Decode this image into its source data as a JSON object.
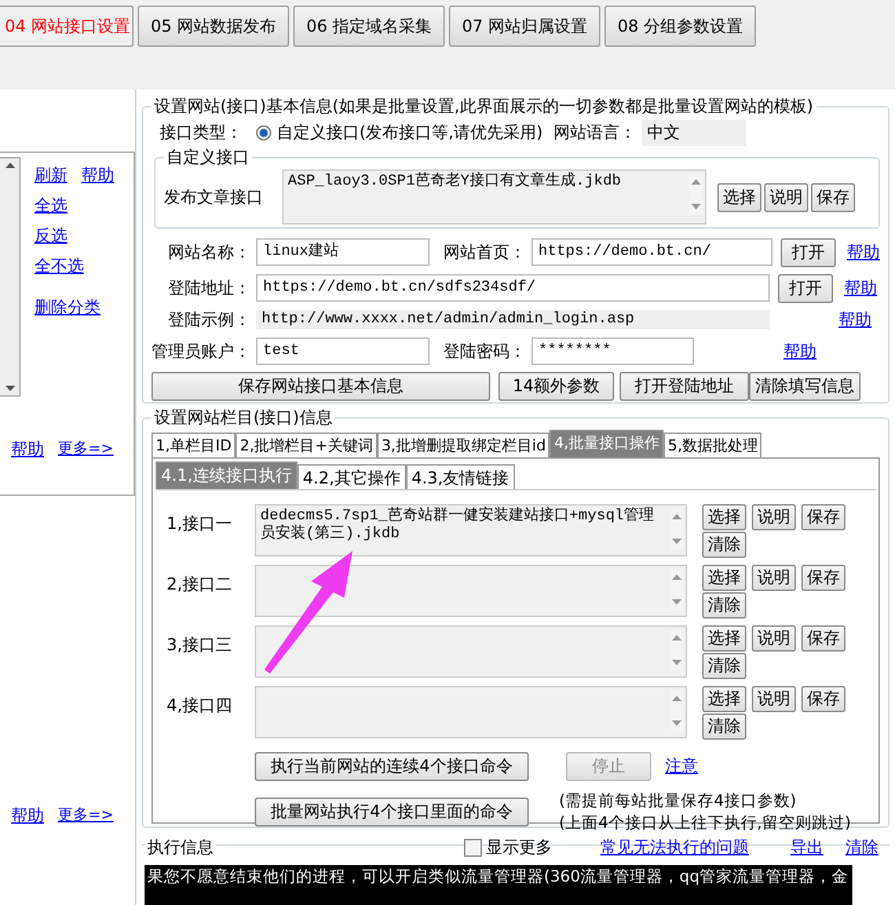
{
  "top_tabs": [
    {
      "label": "04 网站接口设置",
      "selected": true
    },
    {
      "label": "05 网站数据发布",
      "selected": false
    },
    {
      "label": "06 指定域名采集",
      "selected": false
    },
    {
      "label": "07 网站归属设置",
      "selected": false
    },
    {
      "label": "08 分组参数设置",
      "selected": false
    }
  ],
  "left_panel": {
    "links": [
      "刷新",
      "帮助",
      "全选",
      "反选",
      "全不选",
      "删除分类"
    ],
    "footers": [
      {
        "help": "帮助",
        "more": "更多=>"
      },
      {
        "help": "帮助",
        "more": "更多=>"
      }
    ]
  },
  "basic_info": {
    "title": "设置网站(接口)基本信息(如果是批量设置,此界面展示的一切参数都是批量设置网站的模板)",
    "type_label": "接口类型：",
    "type_option": {
      "label": "自定义接口(发布接口等,请优先采用)",
      "selected": true
    },
    "language_label": "网站语言：",
    "language": "中文",
    "custom_title": "自定义接口",
    "publish_label": "发布文章接口",
    "publish_value": "ASP_laoy3.0SP1芭奇老Y接口有文章生成.jkdb",
    "publish_buttons": [
      "选择",
      "说明",
      "保存"
    ],
    "site_name_label": "网站名称：",
    "site_name": "linux建站",
    "home_label": "网站首页：",
    "home": "https://demo.bt.cn/",
    "home_open": "打开",
    "home_help": "帮助",
    "login_label": "登陆地址：",
    "login": "https://demo.bt.cn/sdfs234sdf/",
    "login_open": "打开",
    "login_help": "帮助",
    "example_label": "登陆示例：",
    "example": "http://www.xxxx.net/admin/admin_login.asp",
    "example_help": "帮助",
    "admin_label": "管理员账户：",
    "admin": "test",
    "password_label": "登陆密码：",
    "password": "********",
    "password_help": "帮助",
    "actions": [
      "保存网站接口基本信息",
      "14额外参数",
      "打开登陆地址",
      "清除填写信息"
    ]
  },
  "column_info": {
    "title": "设置网站栏目(接口)信息",
    "tabs": [
      {
        "label": "1,单栏目ID",
        "selected": false
      },
      {
        "label": "2,批增栏目+关键词",
        "selected": false
      },
      {
        "label": "3,批增删提取绑定栏目id",
        "selected": false
      },
      {
        "label": "4,批量接口操作",
        "selected": true
      },
      {
        "label": "5,数据批处理",
        "selected": false
      }
    ],
    "subtabs": [
      {
        "label": "4.1,连续接口执行",
        "selected": true
      },
      {
        "label": "4.2,其它操作",
        "selected": false
      },
      {
        "label": "4.3,友情链接",
        "selected": false
      }
    ],
    "interfaces": [
      {
        "label": "1,接口一",
        "value": "dedecms5.7sp1_芭奇站群一健安装建站接口+mysql管理员安装(第三).jkdb",
        "buttons": [
          "选择",
          "说明",
          "保存",
          "清除"
        ]
      },
      {
        "label": "2,接口二",
        "buttons": [
          "选择",
          "说明",
          "保存",
          "清除"
        ]
      },
      {
        "label": "3,接口三",
        "buttons": [
          "选择",
          "说明",
          "保存",
          "清除"
        ]
      },
      {
        "label": "4,接口四",
        "buttons": [
          "选择",
          "说明",
          "保存",
          "清除"
        ]
      }
    ],
    "run_current": "执行当前网站的连续4个接口命令",
    "stop": {
      "label": "停止",
      "disabled": true
    },
    "note_link": "注意",
    "run_batch": "批量网站执行4个接口里面的命令",
    "hint_1": "(需提前每站批量保存4接口参数)",
    "hint_2": "(上面4个接口从上往下执行,留空则跳过)"
  },
  "exec_info": {
    "title": "执行信息",
    "show_more": {
      "label": "显示更多",
      "checked": false
    },
    "links": [
      "常见无法执行的问题",
      "导出",
      "清除"
    ],
    "log": "果您不愿意结束他们的进程，可以开启类似流量管理器(360流量管理器，qq管家流量管理器，金"
  }
}
